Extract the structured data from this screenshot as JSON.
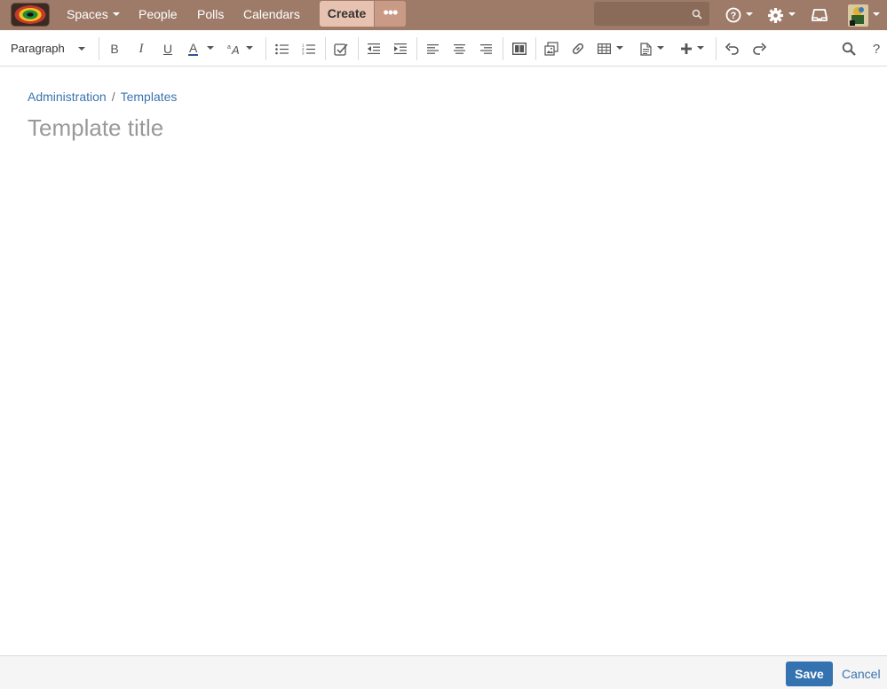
{
  "nav": {
    "spaces": "Spaces",
    "people": "People",
    "polls": "Polls",
    "calendars": "Calendars",
    "create": "Create",
    "more": "•••",
    "search_value": "",
    "icons": [
      "help-icon",
      "gear-icon",
      "notifications-icon",
      "user-avatar"
    ]
  },
  "toolbar": {
    "paragraph": "Paragraph",
    "bold": "B",
    "italic": "I",
    "underline": "U",
    "text_color": "A",
    "text_color_accent": "#2b5797"
  },
  "breadcrumb": {
    "items": [
      "Administration",
      "Templates"
    ],
    "separator": "/"
  },
  "editor": {
    "title_placeholder": "Template title",
    "title_value": ""
  },
  "footer": {
    "save": "Save",
    "cancel": "Cancel"
  },
  "colors": {
    "nav_bg": "#9e7b69",
    "create_bg": "#e7c2b1",
    "link": "#3b73af",
    "primary": "#3572b0"
  }
}
